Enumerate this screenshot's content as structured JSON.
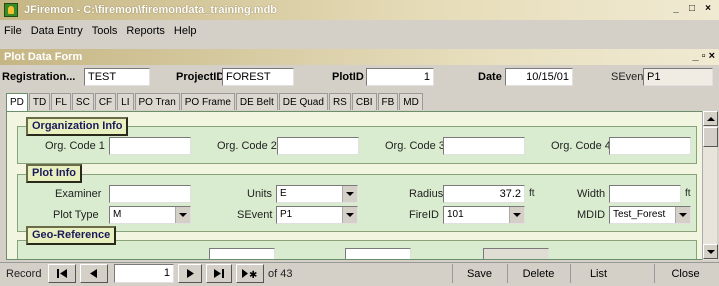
{
  "window": {
    "title": "JFiremon - C:\\firemon\\firemondata_training.mdb",
    "min": "_",
    "max": "□",
    "close": "×"
  },
  "menu": [
    "File",
    "Data Entry",
    "Tools",
    "Reports",
    "Help"
  ],
  "form": {
    "title": "Plot Data Form",
    "min": "_",
    "restore": "▫",
    "close": "×"
  },
  "header": {
    "registration_label": "Registration...",
    "registration_value": "TEST",
    "project_label": "ProjectID",
    "project_value": "FOREST",
    "plot_label": "PlotID",
    "plot_value": "1",
    "date_label": "Date",
    "date_value": "10/15/01",
    "sevent_label": "SEvent",
    "sevent_value": "P1"
  },
  "tabs": [
    "PD",
    "TD",
    "FL",
    "SC",
    "CF",
    "LI",
    "PO Tran",
    "PO Frame",
    "DE Belt",
    "DE Quad",
    "RS",
    "CBI",
    "FB",
    "MD"
  ],
  "org": {
    "title": "Organization Info",
    "fields": [
      {
        "label": "Org. Code 1",
        "value": ""
      },
      {
        "label": "Org. Code 2",
        "value": ""
      },
      {
        "label": "Org. Code 3",
        "value": ""
      },
      {
        "label": "Org. Code 4",
        "value": ""
      }
    ]
  },
  "plot": {
    "title": "Plot Info",
    "examiner_label": "Examiner",
    "examiner_value": "",
    "units_label": "Units",
    "units_value": "E",
    "radius_label": "Radius",
    "radius_value": "37.2",
    "radius_unit": "ft",
    "width_label": "Width",
    "width_value": "",
    "width_unit": "ft",
    "plottype_label": "Plot Type",
    "plottype_value": "M",
    "sevent_label": "SEvent",
    "sevent_value": "P1",
    "fireid_label": "FireID",
    "fireid_value": "101",
    "mdid_label": "MDID",
    "mdid_value": "Test_Forest"
  },
  "geo": {
    "title": "Geo-Reference"
  },
  "status": {
    "record_label": "Record",
    "record_value": "1",
    "of_text": "of 43",
    "save": "Save",
    "delete": "Delete",
    "list": "List",
    "close": "Close"
  }
}
